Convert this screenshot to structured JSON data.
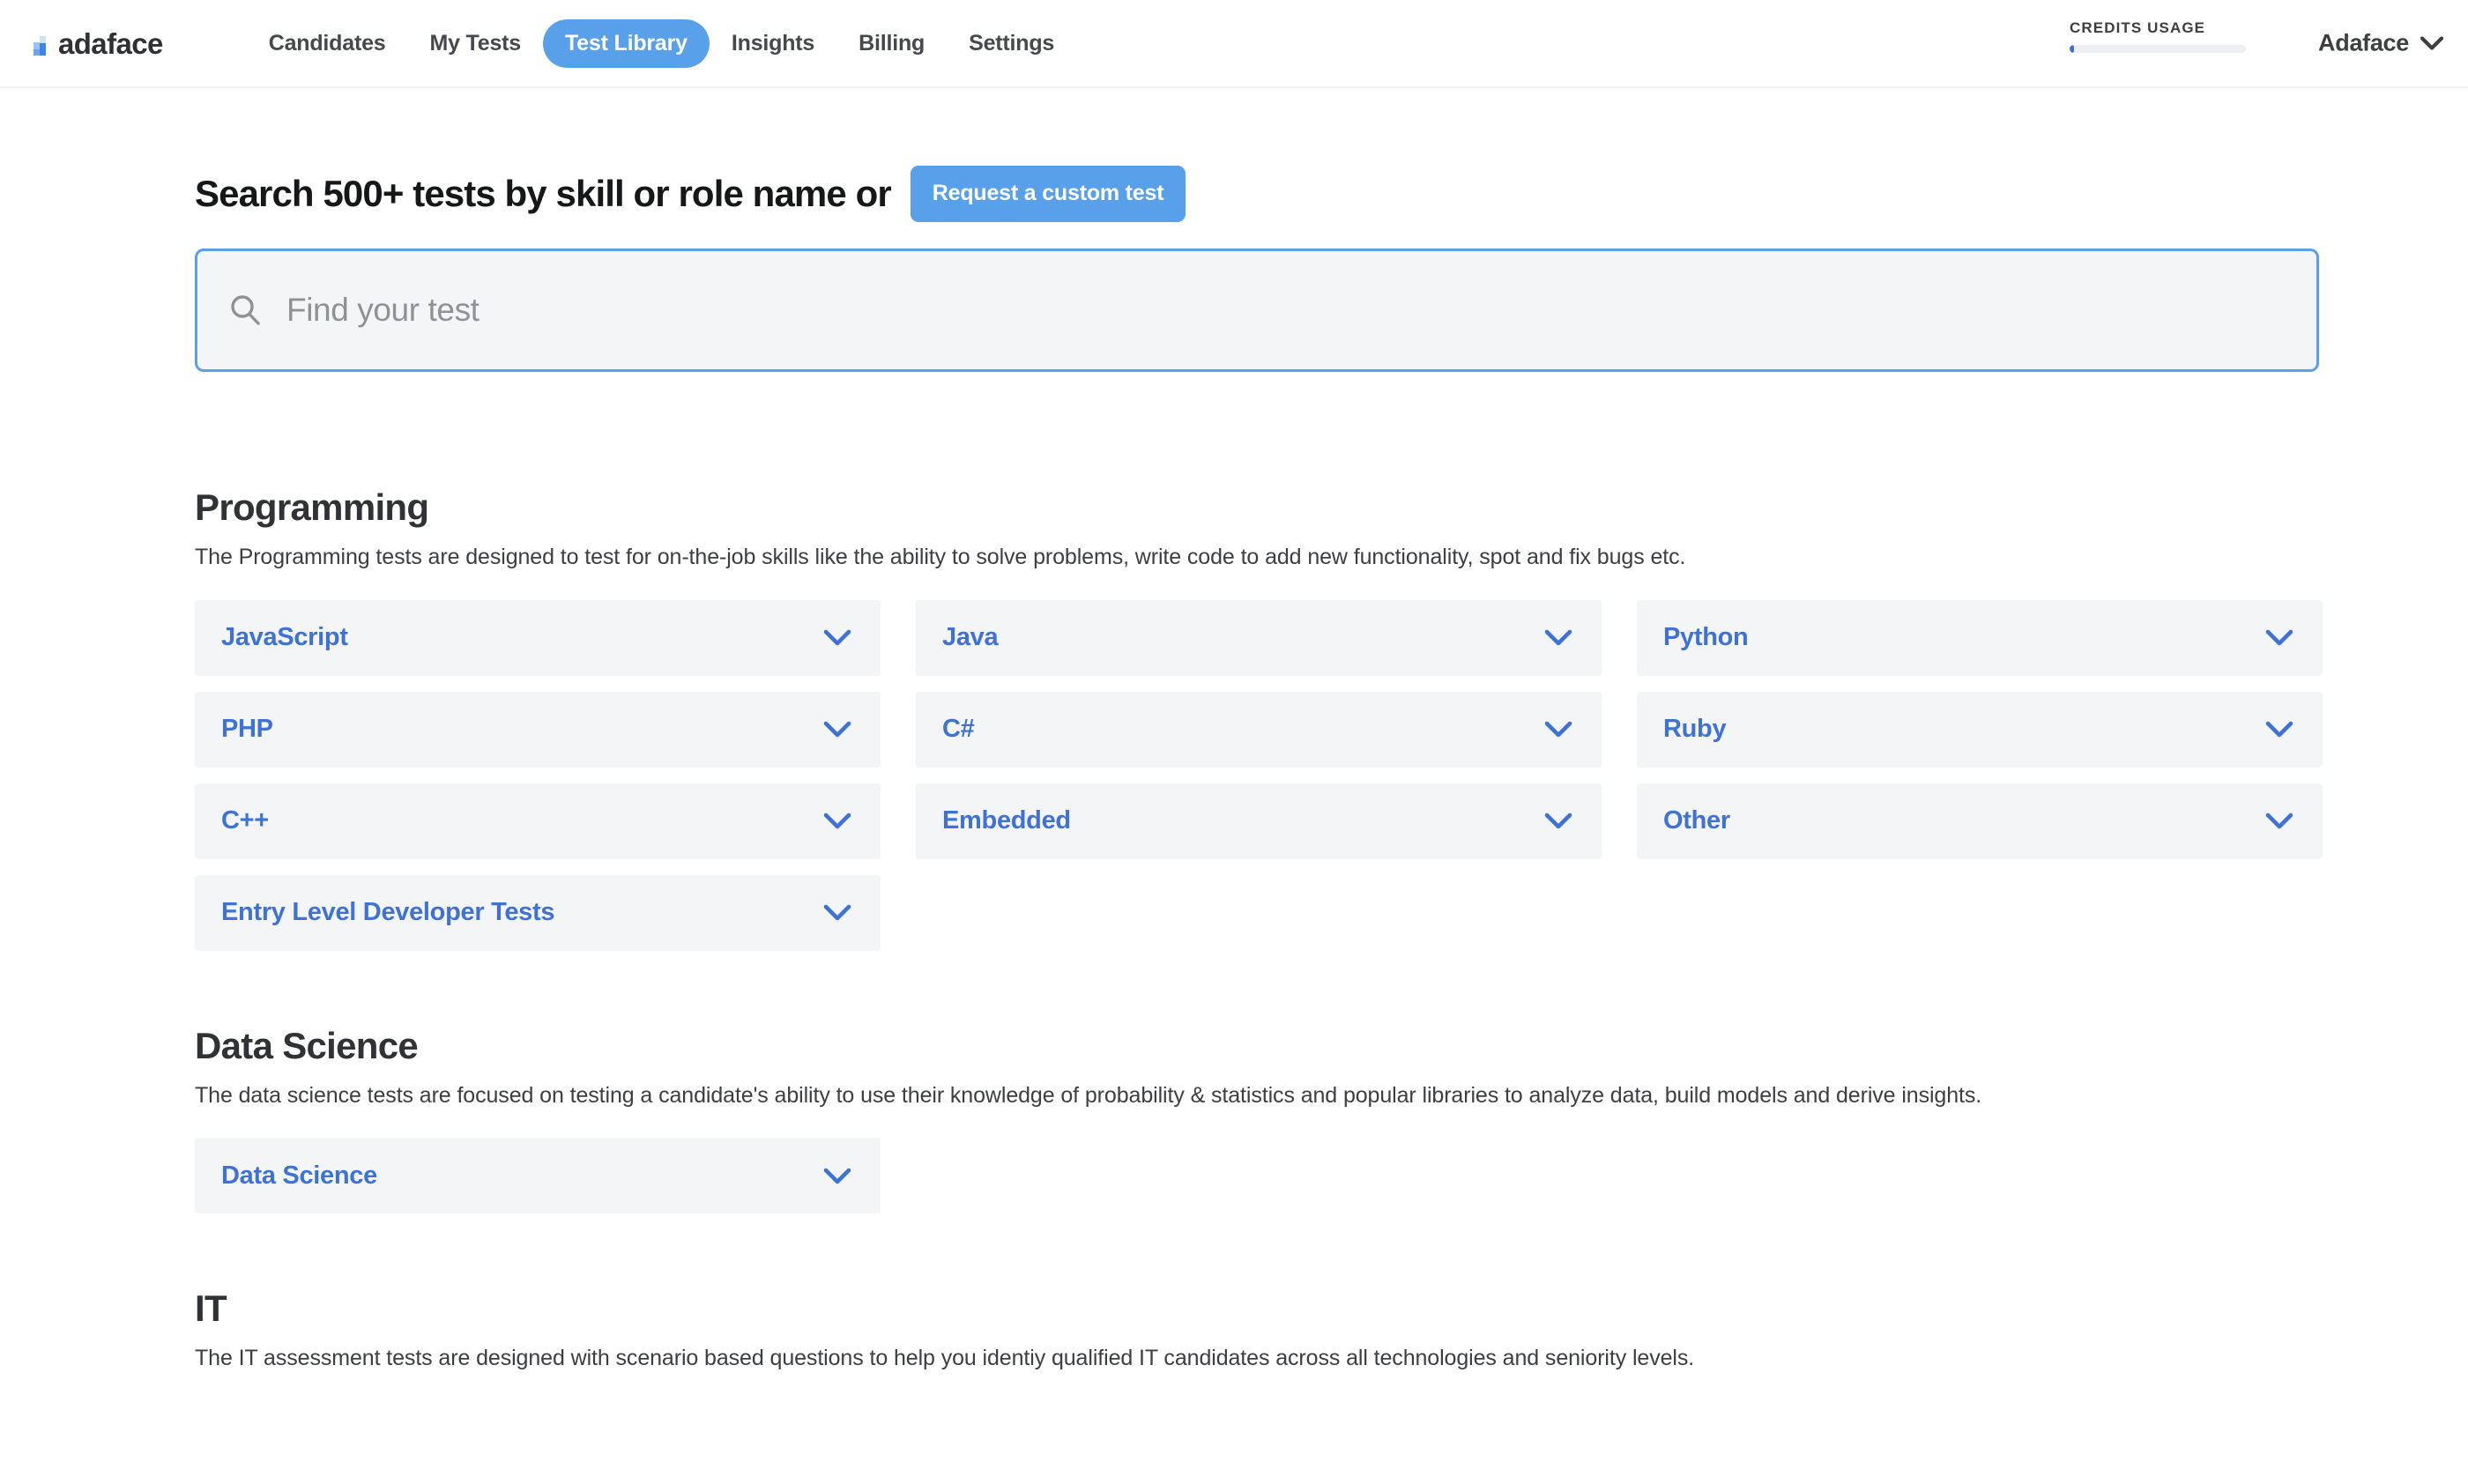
{
  "header": {
    "brand": {
      "name": "adaface",
      "logo_icon": "adaface-bars-logo"
    },
    "nav": [
      {
        "label": "Candidates",
        "active": false
      },
      {
        "label": "My Tests",
        "active": false
      },
      {
        "label": "Test Library",
        "active": true
      },
      {
        "label": "Insights",
        "active": false
      },
      {
        "label": "Billing",
        "active": false
      },
      {
        "label": "Settings",
        "active": false
      }
    ],
    "credits": {
      "label": "CREDITS USAGE",
      "percent": 2.6
    },
    "account": {
      "name": "Adaface",
      "chevron_icon": "chevron-down-icon"
    }
  },
  "search": {
    "title": "Search 500+ tests by skill or role name or",
    "custom_test_button": "Request a custom test",
    "placeholder": "Find your test",
    "value": "",
    "icon": "search-icon"
  },
  "sections": [
    {
      "title": "Programming",
      "description": "The Programming tests are designed to test for on-the-job skills like the ability to solve problems, write code to add new functionality, spot and fix bugs etc.",
      "items": [
        "JavaScript",
        "Java",
        "Python",
        "PHP",
        "C#",
        "Ruby",
        "C++",
        "Embedded",
        "Other",
        "Entry Level Developer Tests"
      ]
    },
    {
      "title": "Data Science",
      "description": "The data science tests are focused on testing a candidate's ability to use their knowledge of probability & statistics and popular libraries to analyze data, build models and derive insights.",
      "items": [
        "Data Science"
      ]
    },
    {
      "title": "IT",
      "description": "The IT assessment tests are designed with scenario based questions to help you identiy qualified IT candidates across all technologies and seniority levels.",
      "items": []
    }
  ],
  "colors": {
    "accent_blue": "#58a0ea",
    "link_blue": "#3f72d6",
    "panel_gray": "#f4f5f6",
    "text_dark": "#303236"
  }
}
